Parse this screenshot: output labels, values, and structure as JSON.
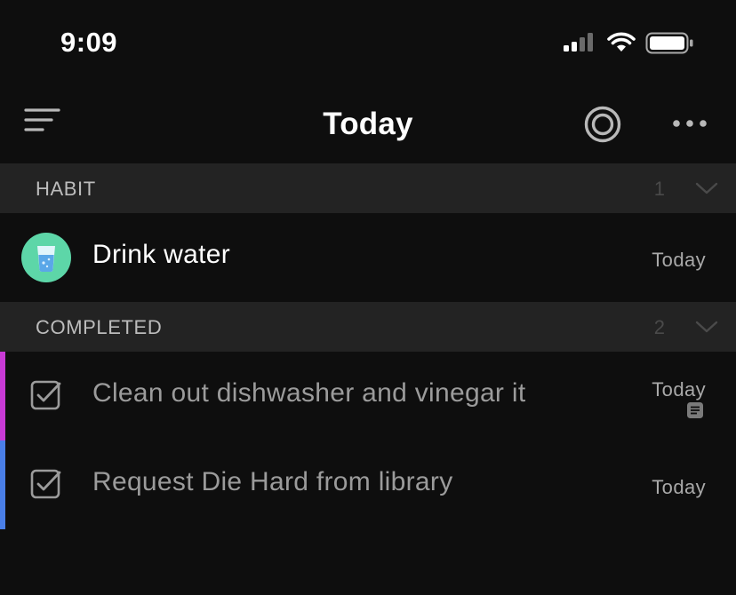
{
  "status_bar": {
    "time": "9:09",
    "icons": [
      "cellular-signal-icon",
      "wifi-icon",
      "battery-icon"
    ]
  },
  "nav": {
    "title": "Today",
    "left_icon": "menu-icon",
    "right_icons": [
      "focus-target-icon",
      "more-options-icon"
    ]
  },
  "sections": [
    {
      "title": "HABIT",
      "count": "1",
      "items": [
        {
          "title": "Drink water",
          "date": "Today",
          "icon": "water-glass-icon"
        }
      ]
    },
    {
      "title": "COMPLETED",
      "count": "2",
      "items": [
        {
          "title": "Clean out dishwasher and vinegar it",
          "date": "Today",
          "checked": true,
          "priority_color": "#c93ad6",
          "has_note": true
        },
        {
          "title": "Request Die Hard from library",
          "date": "Today",
          "checked": true,
          "priority_color": "#4a7fe8",
          "has_note": false
        }
      ]
    }
  ],
  "colors": {
    "background": "#0e0e0e",
    "section_header_bg": "#232323",
    "habit_accent": "#5dd6a8",
    "priority_high": "#c93ad6",
    "priority_medium": "#4a7fe8"
  }
}
